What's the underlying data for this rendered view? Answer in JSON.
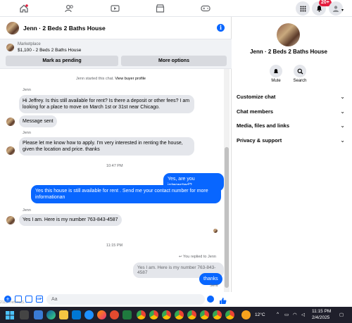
{
  "topbar": {
    "icons": [
      "home-icon",
      "friends-icon",
      "video-icon",
      "marketplace-icon",
      "gaming-icon"
    ],
    "notifications_badge": "20+"
  },
  "chat": {
    "title": "Jenn · 2 Beds 2 Baths House",
    "marketplace_label": "Marketplace",
    "listing": "$1,100 - 2 Beds 2 Baths House",
    "mark_pending": "Mark as pending",
    "more_options": "More options",
    "started_text": "Jenn started this chat.",
    "view_profile": "View buyer profile",
    "sender_1": "Jenn",
    "msg_1": "Hi Jeffrey. Is this still available for rent? Is there a deposit or other fees? I am looking for a place to move on March 1st or 31st near Chicago.",
    "msg_2": "Message sent",
    "sender_2": "Jenn",
    "msg_3": "Please let me know how to apply. I'm very interested in renting the house, given the location and price. thanks",
    "time_1": "10:47 PM",
    "out_1": "Yes, are you interested?",
    "out_2": "Yes this house is still available for rent . Send me your contact number for more informationan",
    "sender_3": "Jenn",
    "msg_4": "Yes I am. Here is my number 763-843-4587",
    "time_2": "11:15 PM",
    "replied_label": "You replied to Jenn",
    "quoted": "Yes I am. Here is my number 763-843-4587",
    "out_3": "thanks",
    "sent_status": "Sent",
    "composer_placeholder": "Aa"
  },
  "right_panel": {
    "title": "Jenn · 2 Beds 2 Baths House",
    "mute": "Mute",
    "search": "Search",
    "rows": [
      "Customize chat",
      "Chat members",
      "Media, files and links",
      "Privacy & support"
    ]
  },
  "taskbar": {
    "weather": "12°C",
    "time": "11:15 PM",
    "date": "2/4/2025",
    "url_hint": "2112/?referralS..."
  },
  "colors": {
    "accent": "#0866ff",
    "bubble_in": "#e4e6eb",
    "taskbar": "#1f1f2b"
  }
}
